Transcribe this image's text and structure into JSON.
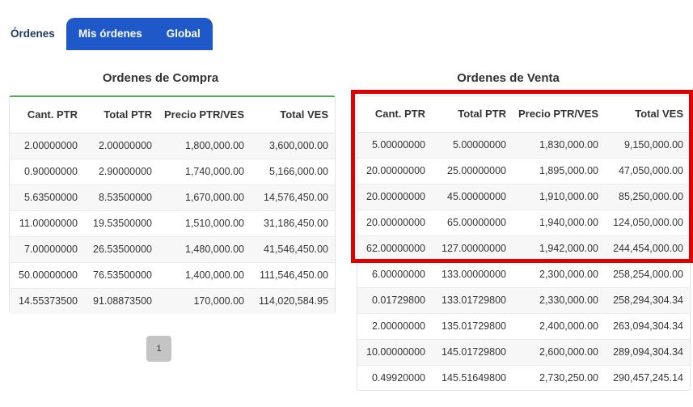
{
  "tabs": {
    "ordenes": "Órdenes",
    "mis_ordenes": "Mis órdenes",
    "global": "Global"
  },
  "buy": {
    "title": "Ordenes de Compra",
    "headers": [
      "Cant. PTR",
      "Total PTR",
      "Precio PTR/VES",
      "Total VES"
    ],
    "rows": [
      [
        "2.00000000",
        "2.00000000",
        "1,800,000.00",
        "3,600,000.00"
      ],
      [
        "0.90000000",
        "2.90000000",
        "1,740,000.00",
        "5,166,000.00"
      ],
      [
        "5.63500000",
        "8.53500000",
        "1,670,000.00",
        "14,576,450.00"
      ],
      [
        "11.00000000",
        "19.53500000",
        "1,510,000.00",
        "31,186,450.00"
      ],
      [
        "7.00000000",
        "26.53500000",
        "1,480,000.00",
        "41,546,450.00"
      ],
      [
        "50.00000000",
        "76.53500000",
        "1,400,000.00",
        "111,546,450.00"
      ],
      [
        "14.55373500",
        "91.08873500",
        "170,000.00",
        "114,020,584.95"
      ]
    ]
  },
  "sell": {
    "title": "Ordenes de Venta",
    "headers": [
      "Cant. PTR",
      "Total PTR",
      "Precio PTR/VES",
      "Total VES"
    ],
    "rows": [
      [
        "5.00000000",
        "5.00000000",
        "1,830,000.00",
        "9,150,000.00"
      ],
      [
        "20.00000000",
        "25.00000000",
        "1,895,000.00",
        "47,050,000.00"
      ],
      [
        "20.00000000",
        "45.00000000",
        "1,910,000.00",
        "85,250,000.00"
      ],
      [
        "20.00000000",
        "65.00000000",
        "1,940,000.00",
        "124,050,000.00"
      ],
      [
        "62.00000000",
        "127.00000000",
        "1,942,000.00",
        "244,454,000.00"
      ],
      [
        "6.00000000",
        "133.00000000",
        "2,300,000.00",
        "258,254,000.00"
      ],
      [
        "0.01729800",
        "133.01729800",
        "2,330,000.00",
        "258,294,304.34"
      ],
      [
        "2.00000000",
        "135.01729800",
        "2,400,000.00",
        "263,094,304.34"
      ],
      [
        "10.00000000",
        "145.01729800",
        "2,600,000.00",
        "289,094,304.34"
      ],
      [
        "0.49920000",
        "145.51649800",
        "2,730,250.00",
        "290,457,245.14"
      ]
    ]
  },
  "pagination": {
    "page": "1"
  },
  "colors": {
    "tab_blue": "#1f58c8",
    "highlight": "#e00000",
    "buy_accent": "#4cae4c"
  }
}
